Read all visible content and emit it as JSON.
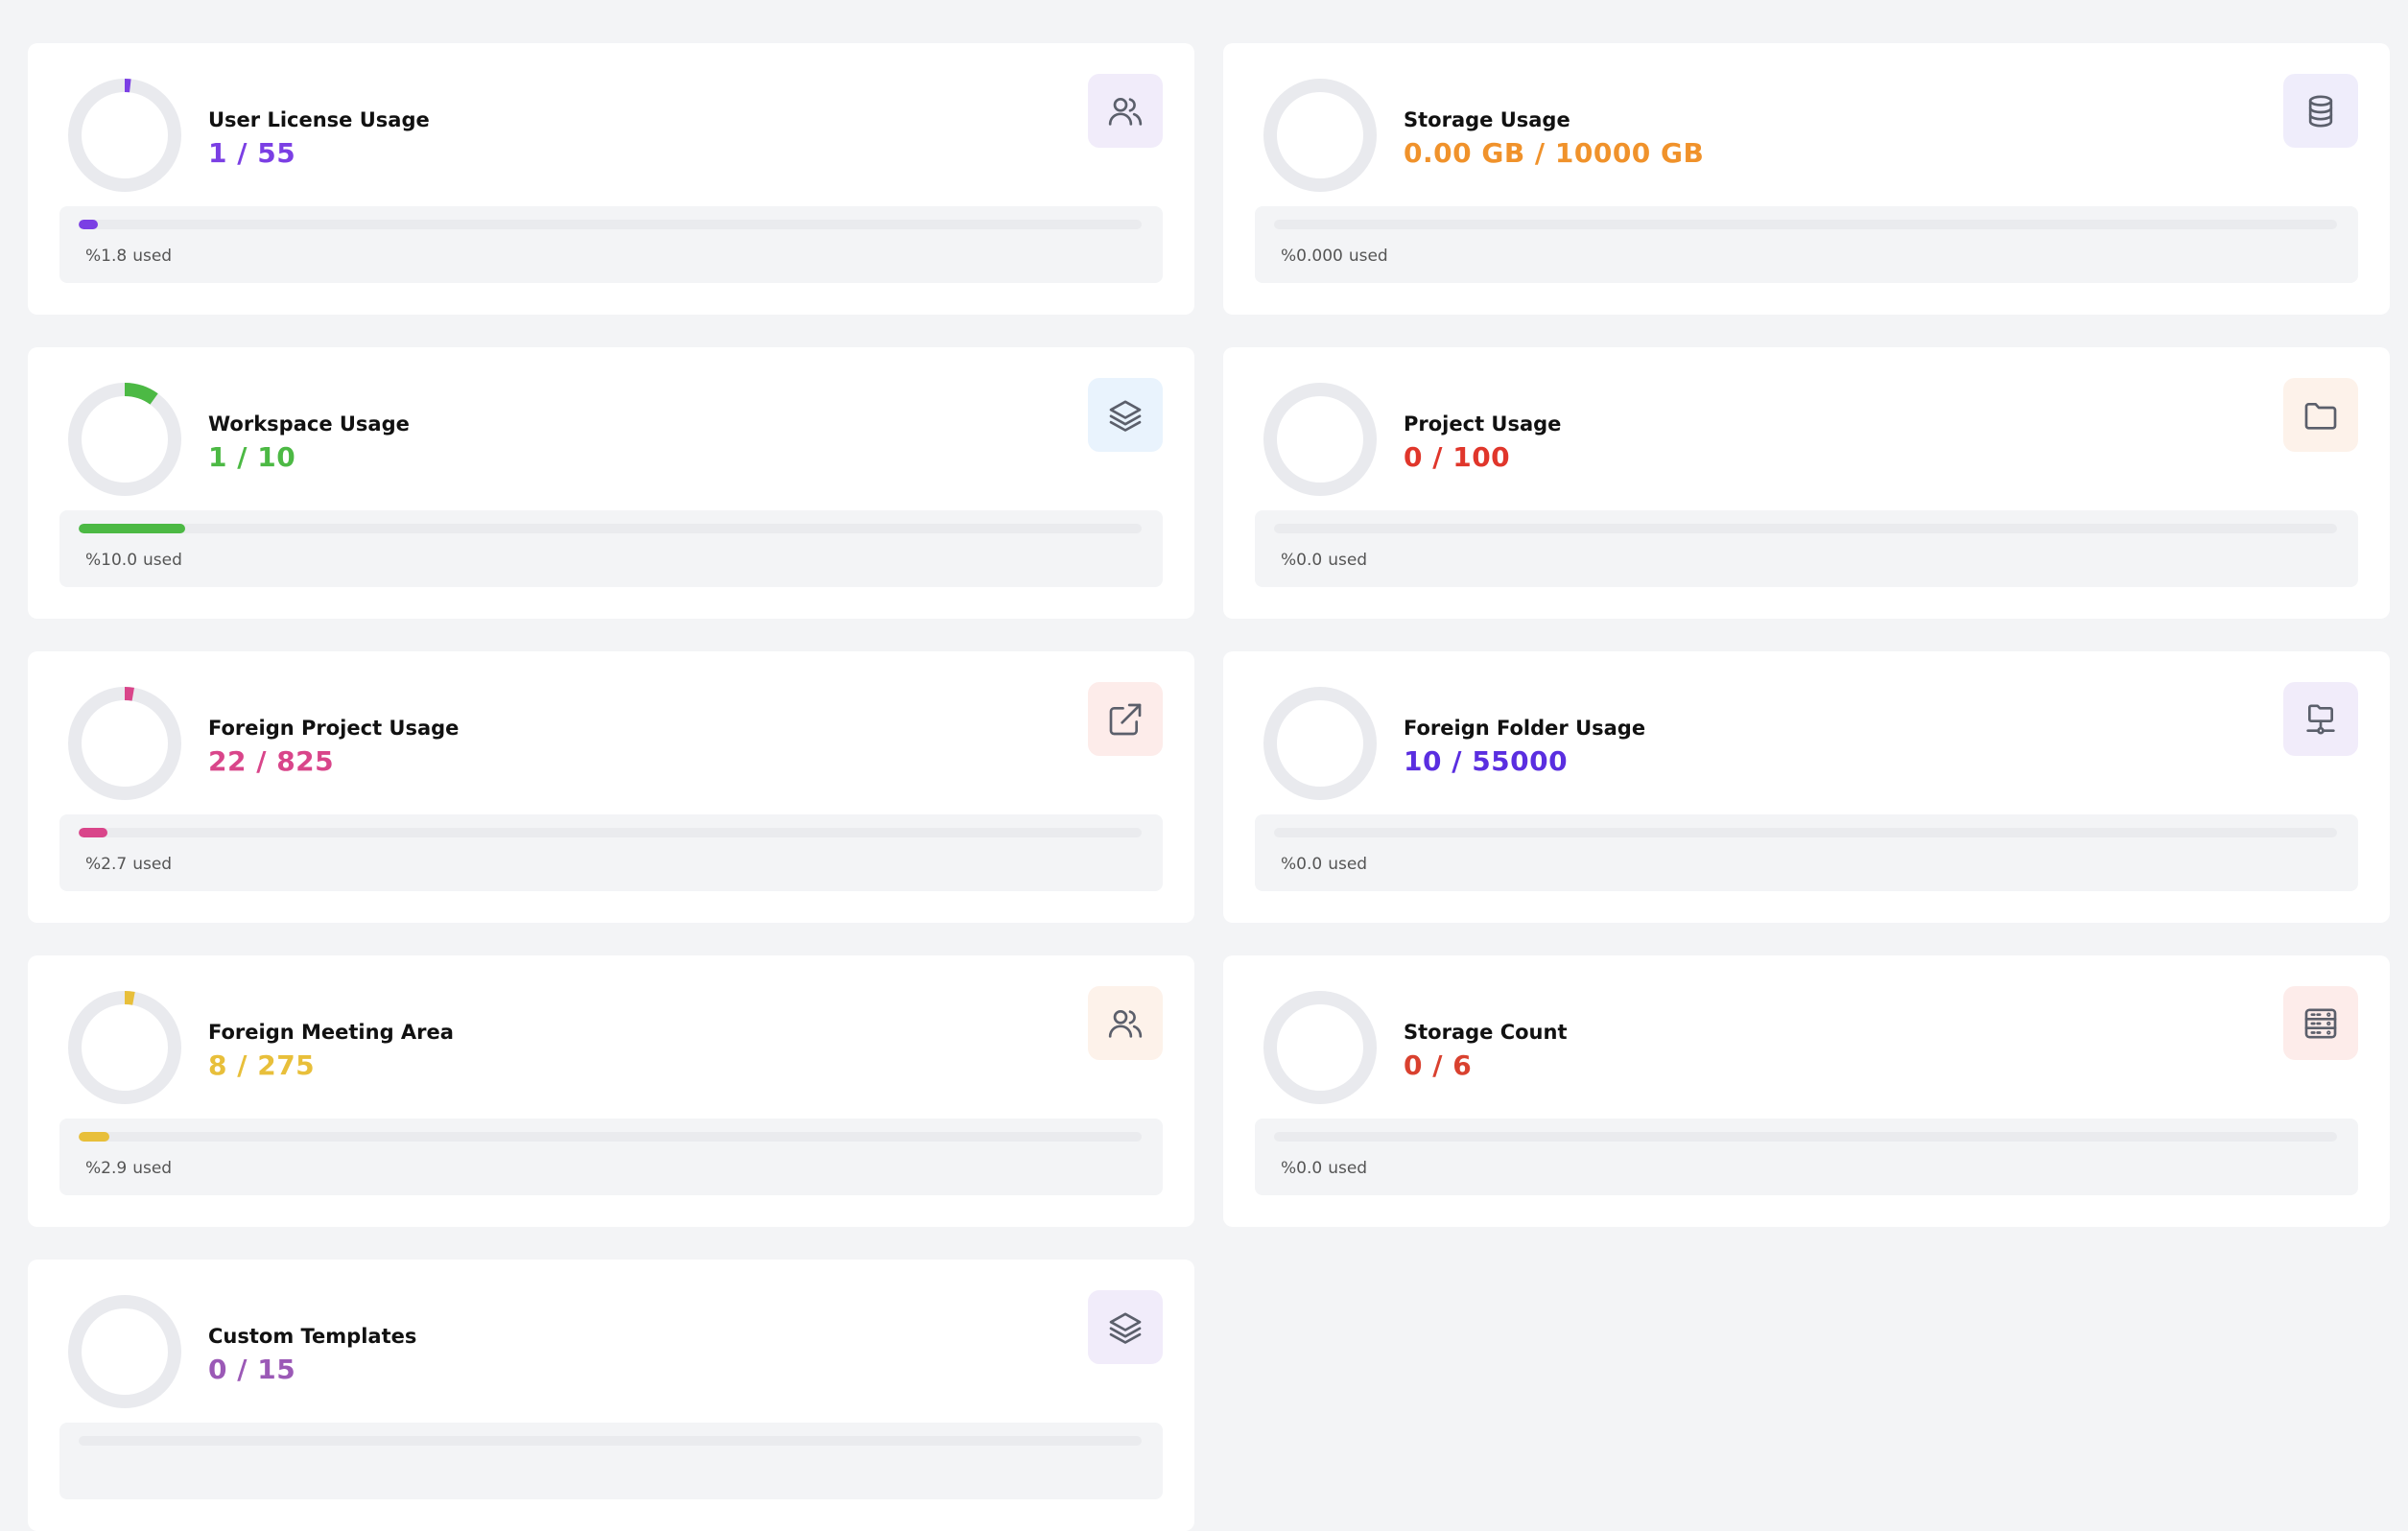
{
  "used_suffix": "used",
  "cards": [
    {
      "title": "User License Usage",
      "value": "1 / 55",
      "percent_label": "%1.8",
      "fraction": 0.018,
      "color": "#7b3fe4",
      "icon": "users-icon",
      "icon_bg": "#f1ecfa"
    },
    {
      "title": "Storage Usage",
      "value": "0.00 GB / 10000 GB",
      "percent_label": "%0.000",
      "fraction": 0,
      "color": "#f0922b",
      "icon": "database-icon",
      "icon_bg": "#efedfb"
    },
    {
      "title": "Workspace Usage",
      "value": "1 / 10",
      "percent_label": "%10.0",
      "fraction": 0.1,
      "color": "#4cb944",
      "icon": "layers-icon",
      "icon_bg": "#e9f3fd"
    },
    {
      "title": "Project Usage",
      "value": "0 / 100",
      "percent_label": "%0.0",
      "fraction": 0,
      "color": "#e0362b",
      "icon": "folder-icon",
      "icon_bg": "#fdf2ea"
    },
    {
      "title": "Foreign Project Usage",
      "value": "22 / 825",
      "percent_label": "%2.7",
      "fraction": 0.027,
      "color": "#d9458a",
      "icon": "external-link-icon",
      "icon_bg": "#fdecea"
    },
    {
      "title": "Foreign Folder Usage",
      "value": "10 / 55000",
      "percent_label": "%0.0",
      "fraction": 0,
      "color": "#5a2ee0",
      "icon": "folder-network-icon",
      "icon_bg": "#f1ecfa"
    },
    {
      "title": "Foreign Meeting Area",
      "value": "8 / 275",
      "percent_label": "%2.9",
      "fraction": 0.029,
      "color": "#e8bf3a",
      "icon": "users-icon",
      "icon_bg": "#fdf2ea"
    },
    {
      "title": "Storage Count",
      "value": "0 / 6",
      "percent_label": "%0.0",
      "fraction": 0,
      "color": "#d9412f",
      "icon": "server-icon",
      "icon_bg": "#fdecea"
    },
    {
      "title": "Custom Templates",
      "value": "0 / 15",
      "percent_label": "",
      "fraction": 0,
      "color": "#9b59b6",
      "icon": "layers-icon",
      "icon_bg": "#f1ecfa"
    }
  ]
}
